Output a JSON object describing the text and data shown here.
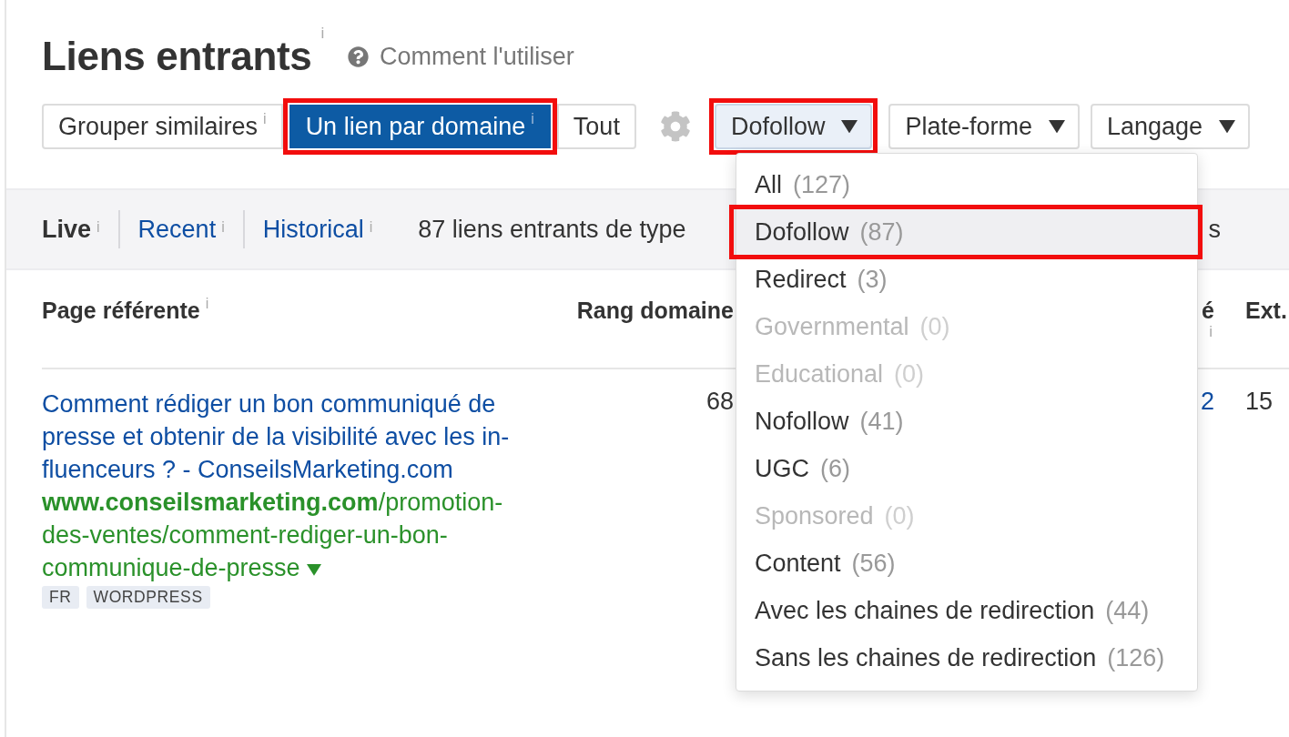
{
  "header": {
    "title": "Liens entrants",
    "title_info": "i",
    "help_link": "Comment l'utiliser"
  },
  "mode_buttons": [
    {
      "label": "Grouper similaires",
      "info": "i",
      "selected": false,
      "highlighted": false
    },
    {
      "label": "Un lien par domaine",
      "info": "i",
      "selected": true,
      "highlighted": true
    },
    {
      "label": "Tout",
      "selected": false,
      "highlighted": false
    }
  ],
  "filters": [
    {
      "label": "Dofollow",
      "open": true,
      "highlighted": true
    },
    {
      "label": "Plate-forme",
      "open": false,
      "highlighted": false
    },
    {
      "label": "Langage",
      "open": false,
      "highlighted": false
    }
  ],
  "dropdown": {
    "items": [
      {
        "label": "All",
        "count": "(127)",
        "disabled": false,
        "selected": false,
        "highlighted": false
      },
      {
        "label": "Dofollow",
        "count": "(87)",
        "disabled": false,
        "selected": true,
        "highlighted": true
      },
      {
        "label": "Redirect",
        "count": "(3)",
        "disabled": false,
        "selected": false,
        "highlighted": false
      },
      {
        "label": "Governmental",
        "count": "(0)",
        "disabled": true,
        "selected": false,
        "highlighted": false
      },
      {
        "label": "Educational",
        "count": "(0)",
        "disabled": true,
        "selected": false,
        "highlighted": false
      },
      {
        "label": "Nofollow",
        "count": "(41)",
        "disabled": false,
        "selected": false,
        "highlighted": false
      },
      {
        "label": "UGC",
        "count": "(6)",
        "disabled": false,
        "selected": false,
        "highlighted": false
      },
      {
        "label": "Sponsored",
        "count": "(0)",
        "disabled": true,
        "selected": false,
        "highlighted": false
      },
      {
        "label": "Content",
        "count": "(56)",
        "disabled": false,
        "selected": false,
        "highlighted": false
      },
      {
        "label": "Avec les chaines de redirection",
        "count": "(44)",
        "disabled": false,
        "selected": false,
        "highlighted": false
      },
      {
        "label": "Sans les chaines de redirection",
        "count": "(126)",
        "disabled": false,
        "selected": false,
        "highlighted": false
      }
    ]
  },
  "tabs": [
    {
      "label": "Live",
      "info": "i",
      "selected": true
    },
    {
      "label": "Recent",
      "info": "i",
      "selected": false
    },
    {
      "label": "Historical",
      "info": "i",
      "selected": false
    }
  ],
  "summary": {
    "text": "87 liens entrants de type",
    "tail": "s"
  },
  "table": {
    "columns": [
      {
        "label": "Page référente",
        "info": "i"
      },
      {
        "label": "Rang domaine"
      },
      {
        "label": "é",
        "info": "i"
      },
      {
        "label": "Ext."
      }
    ],
    "rows": [
      {
        "title": "Comment rédiger un bon communiqué de presse et obtenir de la visibilité avec les in-fluenceurs ? - ConseilsMarketing.com",
        "url_domain": "www.conseilsmarketing.com",
        "url_path": "/promotion-des-ventes/comment-rediger-un-bon-communique-de-presse",
        "tags": [
          "FR",
          "WORDPRESS"
        ],
        "domain_rating": "68",
        "column_3": "2",
        "column_4": "15"
      }
    ]
  }
}
